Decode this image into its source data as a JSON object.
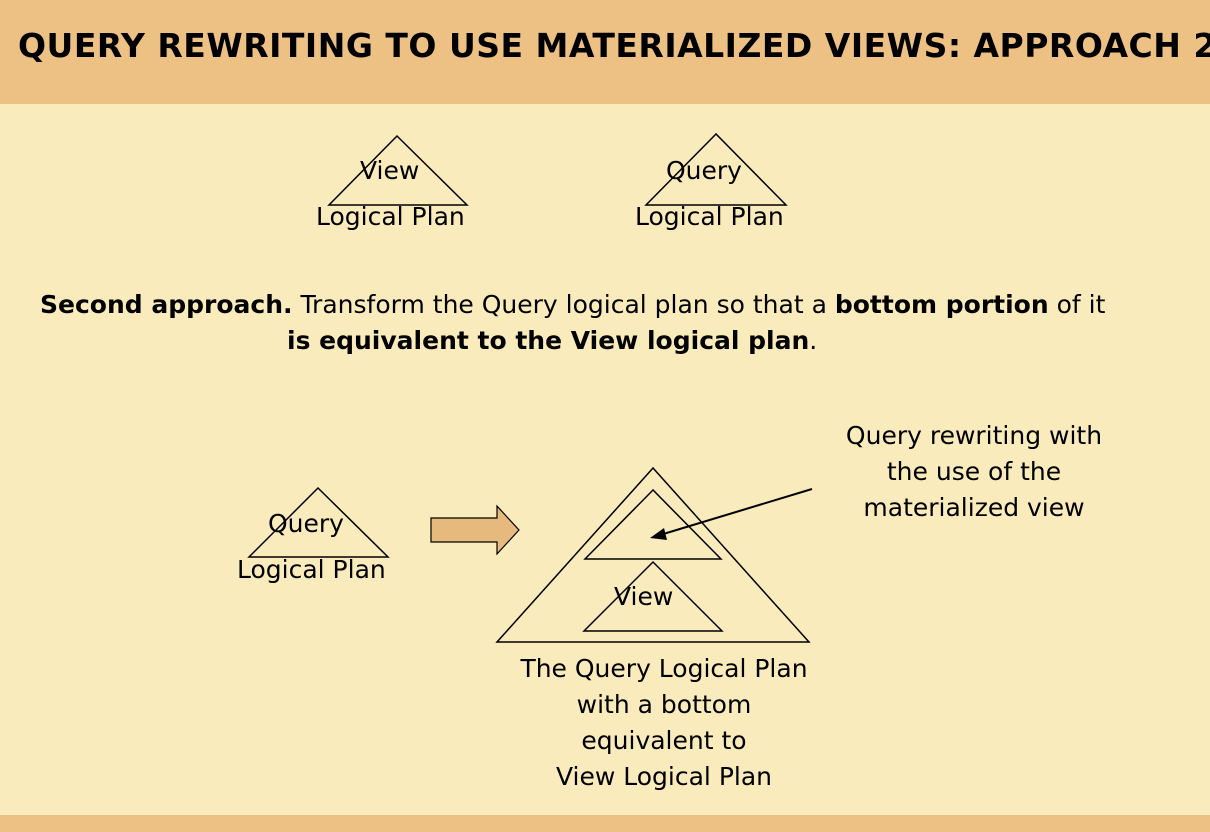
{
  "header": {
    "title": "QUERY REWRITING TO USE MATERIALIZED VIEWS: APPROACH 2"
  },
  "top_diagrams": {
    "view_label": "View",
    "view_plan_label": "Logical Plan",
    "query_label": "Query",
    "query_plan_label": "Logical Plan"
  },
  "paragraph": {
    "lead": "Second approach.",
    "text1": " Transform the Query logical plan so that a ",
    "bold1": "bottom portion",
    "text2": " of it",
    "bold2": "is equivalent to the View logical plan",
    "text3": "."
  },
  "bottom_diagram": {
    "query_label": "Query",
    "query_plan_label": "Logical Plan",
    "inner_view_label": "View",
    "callout": [
      "Query rewriting with",
      "the use of the",
      "materialized view"
    ],
    "caption": [
      "The Query Logical Plan",
      "with a bottom",
      "equivalent to",
      "View Logical Plan"
    ]
  },
  "colors": {
    "background": "#f9ebbb",
    "header_band": "#edc083",
    "arrow_fill": "#e6b97c"
  }
}
